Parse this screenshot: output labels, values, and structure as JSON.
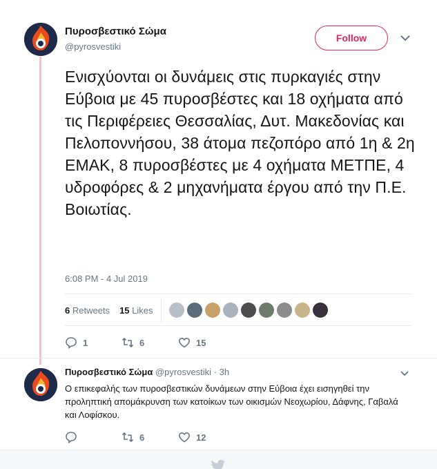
{
  "author": {
    "name": "Πυροσβεστικό Σώμα",
    "handle": "@pyrosvestiki",
    "follow_label": "Follow"
  },
  "tweet": {
    "text": "Ενισχύονται οι δυνάμεις στις  πυρκαγιές στην Εύβοια με 45 πυροσβέστες και 18 οχήματα από τις Περιφέρειες Θεσσαλίας, Δυτ. Μακεδονίας και Πελοποννήσου, 38 άτομα πεζοπόρο από 1η & 2η ΕΜΑΚ, 8 πυροσβέστες με 4 οχήματα ΜΕΤΠΕ, 4 υδροφόρες & 2 μηχανήματα έργου από την Π.Ε. Βοιωτίας.",
    "timestamp": "6:08 PM - 4 Jul 2019",
    "retweets_count": "6",
    "retweets_label": "Retweets",
    "likes_count": "15",
    "likes_label": "Likes",
    "actions": {
      "reply": "1",
      "retweet": "6",
      "like": "15"
    }
  },
  "reply": {
    "name": "Πυροσβεστικό Σώμα",
    "handle": "@pyrosvestiki",
    "time": "· 3h",
    "text": "Ο επικεφαλής των πυροσβεστικών δυνάμεων στην Εύβοια έχει εισηγηθεί  την προληπτική απομάκρυνση των κατοίκων των οικισμών Νεοχωρίου, Δάφνης, Γαβαλά και Λοφίσκου.",
    "actions": {
      "reply": "",
      "retweet": "6",
      "like": "12"
    }
  },
  "colors": {
    "accent": "#e0245e",
    "muted": "#657786",
    "thread": "#f4c2c2"
  },
  "icons": [
    "chevron-down-icon",
    "reply-icon",
    "retweet-icon",
    "heart-icon",
    "twitter-bird-icon"
  ]
}
